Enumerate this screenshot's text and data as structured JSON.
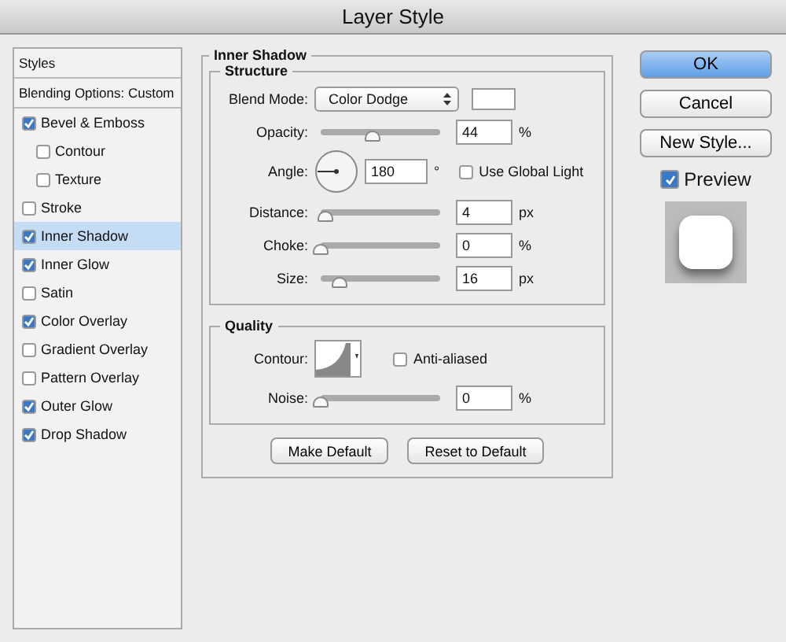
{
  "window": {
    "title": "Layer Style"
  },
  "sidebar": {
    "header": "Styles",
    "blending": "Blending Options: Custom",
    "items": [
      {
        "label": "Bevel & Emboss",
        "checked": true,
        "selected": false,
        "children": [
          {
            "label": "Contour",
            "checked": false,
            "selected": false
          },
          {
            "label": "Texture",
            "checked": false,
            "selected": false
          }
        ]
      },
      {
        "label": "Stroke",
        "checked": false,
        "selected": false
      },
      {
        "label": "Inner Shadow",
        "checked": true,
        "selected": true
      },
      {
        "label": "Inner Glow",
        "checked": true,
        "selected": false
      },
      {
        "label": "Satin",
        "checked": false,
        "selected": false
      },
      {
        "label": "Color Overlay",
        "checked": true,
        "selected": false
      },
      {
        "label": "Gradient Overlay",
        "checked": false,
        "selected": false
      },
      {
        "label": "Pattern Overlay",
        "checked": false,
        "selected": false
      },
      {
        "label": "Outer Glow",
        "checked": true,
        "selected": false
      },
      {
        "label": "Drop Shadow",
        "checked": true,
        "selected": false
      }
    ]
  },
  "panel": {
    "title": "Inner Shadow",
    "structure": {
      "title": "Structure",
      "rows": [
        {
          "kind": "blend",
          "label": "Blend Mode:",
          "value": "Color Dodge"
        },
        {
          "kind": "slider",
          "label": "Opacity:",
          "level": 0.44,
          "value": "44",
          "unit": "%"
        },
        {
          "kind": "angle",
          "label": "Angle:",
          "value": "180",
          "unit": "°",
          "option": "Use Global Light",
          "checked": false
        },
        {
          "kind": "slider",
          "label": "Distance:",
          "level": 0.04,
          "value": "4",
          "unit": "px"
        },
        {
          "kind": "slider",
          "label": "Choke:",
          "level": 0,
          "value": "0",
          "unit": "%"
        },
        {
          "kind": "slider",
          "label": "Size:",
          "level": 0.16,
          "value": "16",
          "unit": "px"
        }
      ]
    },
    "quality": {
      "title": "Quality",
      "rows": [
        {
          "kind": "contour",
          "label": "Contour:",
          "option": "Anti-aliased",
          "checked": false
        },
        {
          "kind": "slider",
          "label": "Noise:",
          "level": 0,
          "value": "0",
          "unit": "%"
        }
      ]
    },
    "buttons": [
      "Make Default",
      "Reset to Default"
    ]
  },
  "actions": [
    {
      "label": "OK",
      "primary": true
    },
    {
      "label": "Cancel",
      "primary": false
    },
    {
      "label": "New Style...",
      "primary": false
    }
  ],
  "preview": {
    "label": "Preview",
    "checked": true
  }
}
